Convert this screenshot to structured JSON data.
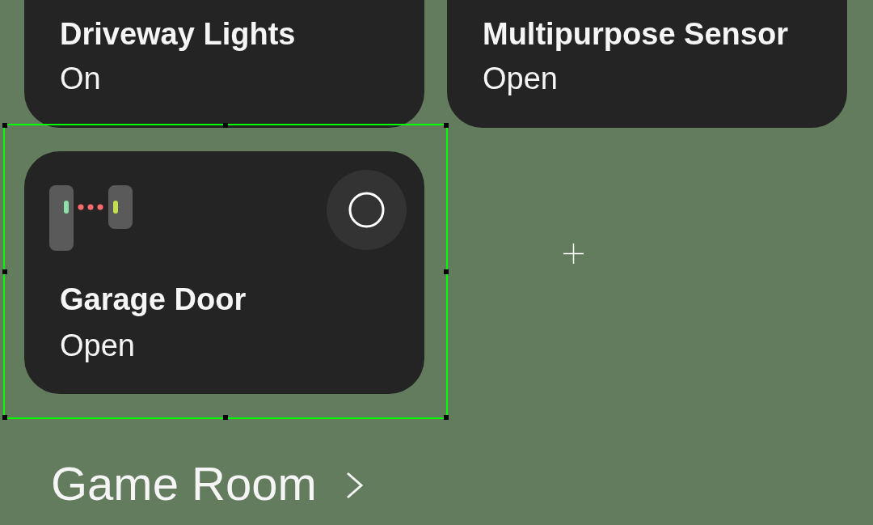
{
  "cards_above": [
    {
      "name": "Driveway Lights",
      "status": "On",
      "selected": false
    },
    {
      "name": "Multipurpose Sensor",
      "status": "Open",
      "selected": false
    }
  ],
  "cards": [
    {
      "name": "Garage Door",
      "status": "Open",
      "selected": true,
      "kind": "contact_sensor"
    }
  ],
  "section": {
    "title": "Game Room"
  }
}
